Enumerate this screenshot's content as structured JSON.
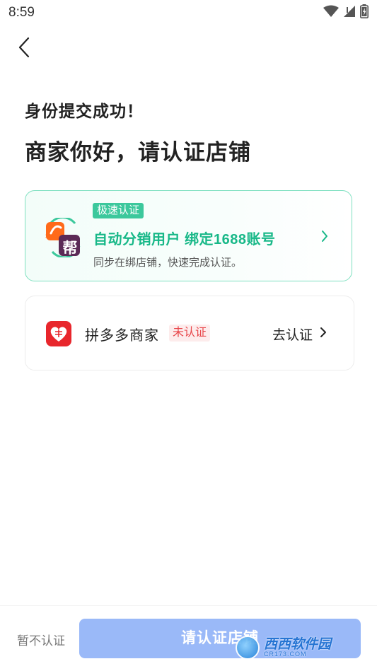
{
  "status_bar": {
    "time": "8:59",
    "icons": [
      "wifi-icon",
      "signal-icon",
      "battery-icon"
    ]
  },
  "header": {
    "back_icon": "back-arrow-icon"
  },
  "page": {
    "subtitle": "身份提交成功！",
    "title": "商家你好，请认证店铺"
  },
  "fast_card": {
    "badge": "极速认证",
    "title": "自动分销用户 绑定1688账号",
    "description": "同步在绑店铺，快速完成认证。",
    "logo_text": "帮",
    "logo_small_text": "1688",
    "accent_color": "#18b888",
    "chevron_icon": "chevron-right-icon"
  },
  "pdd_card": {
    "name": "拼多多商家",
    "status": "未认证",
    "action": "去认证",
    "logo_icon": "pinduoduo-logo-icon",
    "brand_color": "#e8262c"
  },
  "bottom_bar": {
    "skip_label": "暂不认证",
    "submit_label": "请认证店铺",
    "submit_color": "#9ab9f8"
  },
  "watermark": {
    "main": "西西软件园",
    "sub": "CR173.COM"
  }
}
